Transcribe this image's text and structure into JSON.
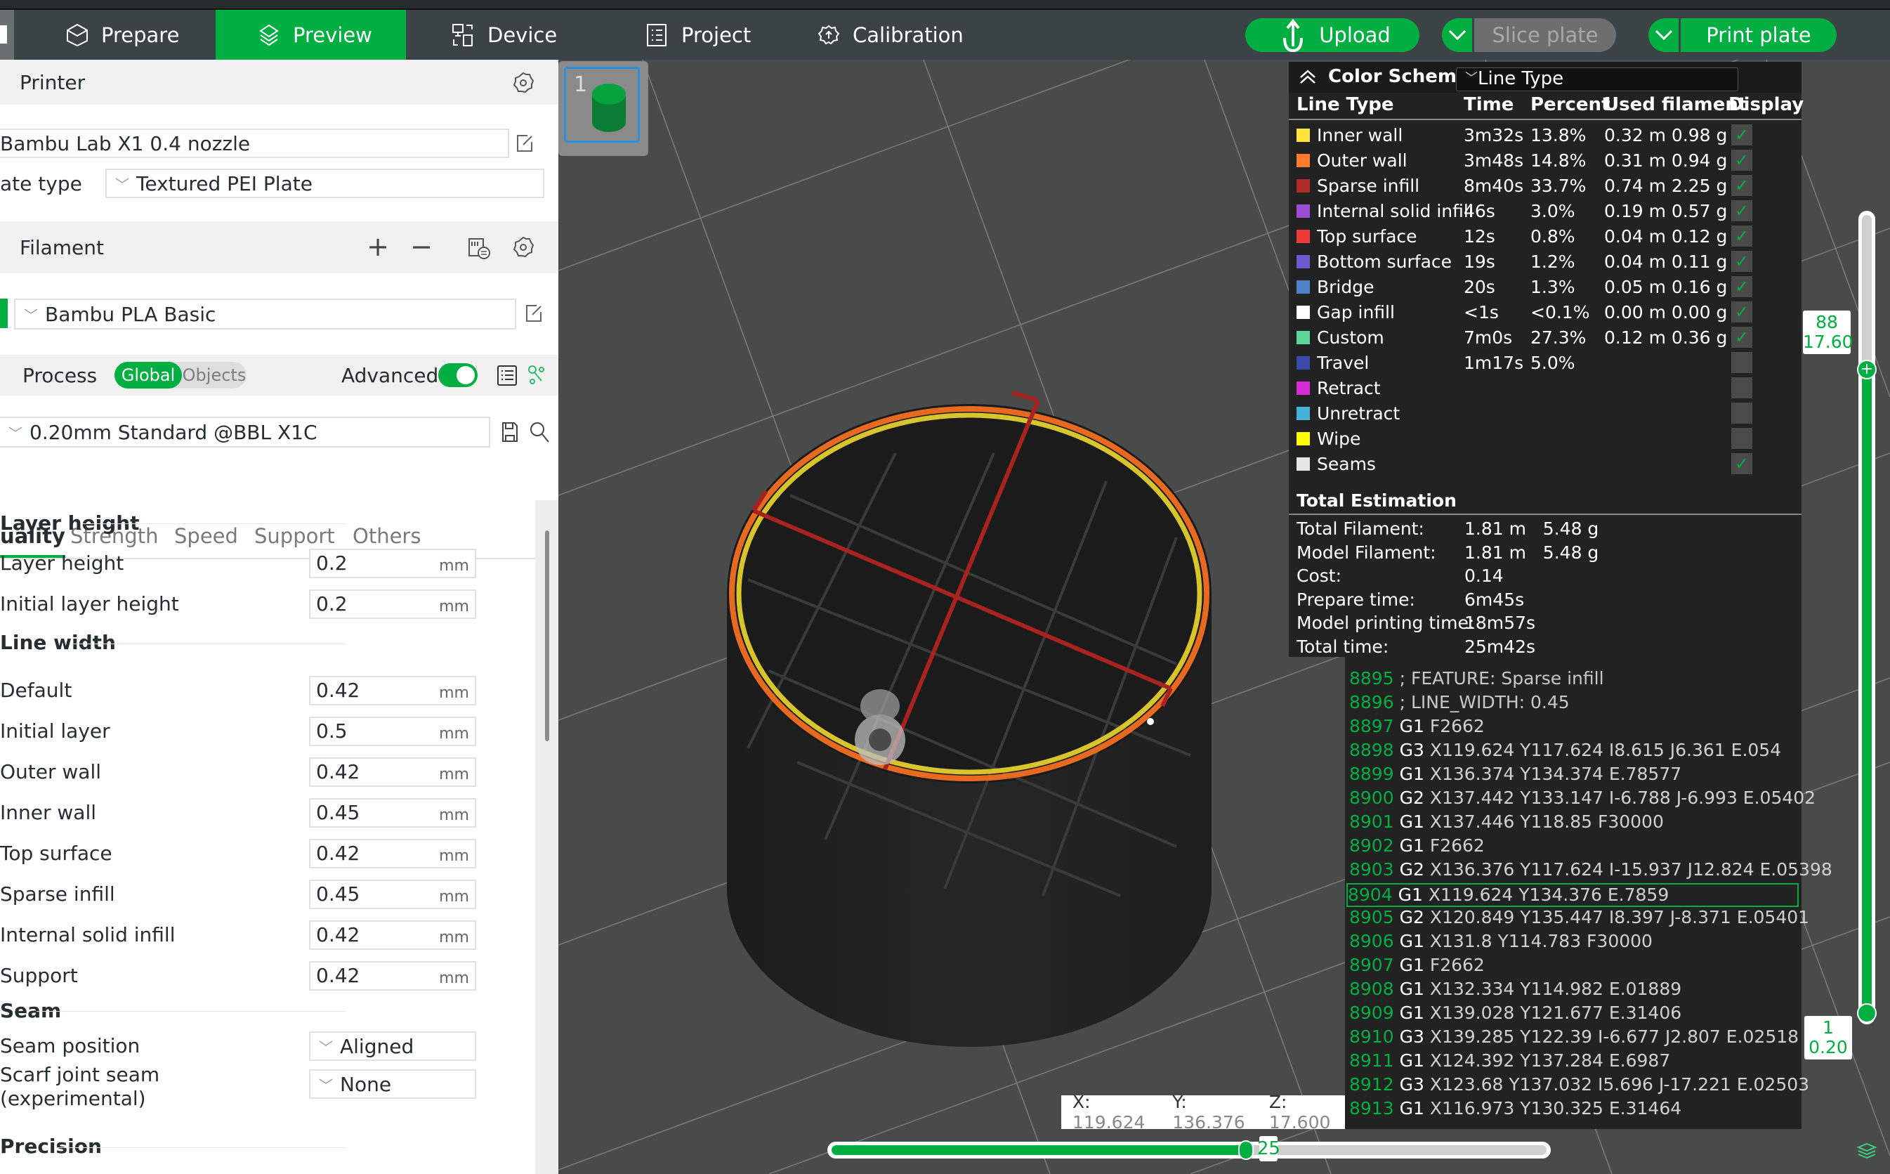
{
  "toolbar": {
    "tabs": [
      {
        "label": "Prepare",
        "icon": "cube-icon",
        "active": false
      },
      {
        "label": "Preview",
        "icon": "layers-icon",
        "active": true
      },
      {
        "label": "Device",
        "icon": "device-icon",
        "active": false
      },
      {
        "label": "Project",
        "icon": "list-icon",
        "active": false
      },
      {
        "label": "Calibration",
        "icon": "calibration-gear-icon",
        "active": false
      }
    ],
    "upload_label": "Upload",
    "slice_label": "Slice plate",
    "print_label": "Print plate",
    "colors": {
      "accent": "#00ae42",
      "toolbar_bg": "#3c4346",
      "disabled": "#6e6e6e"
    }
  },
  "printer": {
    "section_title": "Printer",
    "printer_name": "Bambu Lab X1 0.4 nozzle",
    "plate_type_label": "ate type",
    "plate_type_value": "Textured PEI Plate"
  },
  "filament": {
    "section_title": "Filament",
    "add_icon": "+",
    "remove_icon": "−",
    "items": [
      {
        "name": "Bambu PLA Basic",
        "color": "#00ae42"
      }
    ]
  },
  "process": {
    "section_title": "Process",
    "scope_global": "Global",
    "scope_objects": "Objects",
    "advanced_label": "Advanced",
    "advanced_on": true,
    "preset": "0.20mm Standard @BBL X1C",
    "tabs": [
      "uality",
      "Strength",
      "Speed",
      "Support",
      "Others"
    ],
    "active_tab": 0,
    "groups": {
      "layer_height": {
        "title": "Layer height",
        "rows": [
          {
            "label": "Layer height",
            "value": "0.2",
            "unit": "mm"
          },
          {
            "label": "Initial layer height",
            "value": "0.2",
            "unit": "mm"
          }
        ]
      },
      "line_width": {
        "title": "Line width",
        "rows": [
          {
            "label": "Default",
            "value": "0.42",
            "unit": "mm"
          },
          {
            "label": "Initial layer",
            "value": "0.5",
            "unit": "mm"
          },
          {
            "label": "Outer wall",
            "value": "0.42",
            "unit": "mm"
          },
          {
            "label": "Inner wall",
            "value": "0.45",
            "unit": "mm"
          },
          {
            "label": "Top surface",
            "value": "0.42",
            "unit": "mm"
          },
          {
            "label": "Sparse infill",
            "value": "0.45",
            "unit": "mm"
          },
          {
            "label": "Internal solid infill",
            "value": "0.42",
            "unit": "mm"
          },
          {
            "label": "Support",
            "value": "0.42",
            "unit": "mm"
          }
        ]
      },
      "seam": {
        "title": "Seam",
        "seam_position_label": "Seam position",
        "seam_position_value": "Aligned",
        "scarf_label_1": "Scarf joint seam",
        "scarf_label_2": "(experimental)",
        "scarf_value": "None"
      },
      "precision": {
        "title": "Precision"
      }
    }
  },
  "plate": {
    "number": "1"
  },
  "legend": {
    "color_scheme_label": "Color Scheme",
    "color_scheme_value": "Line Type",
    "columns": [
      "Line Type",
      "Time",
      "Percent",
      "Used filament",
      "Display"
    ],
    "rows": [
      {
        "name": "Inner wall",
        "color": "#ffe53b",
        "time": "3m32s",
        "percent": "13.8%",
        "used": "0.32 m 0.98 g",
        "display": true
      },
      {
        "name": "Outer wall",
        "color": "#ff7b2e",
        "time": "3m48s",
        "percent": "14.8%",
        "used": "0.31 m 0.94 g",
        "display": true
      },
      {
        "name": "Sparse infill",
        "color": "#b02a28",
        "time": "8m40s",
        "percent": "33.7%",
        "used": "0.74 m 2.25 g",
        "display": true
      },
      {
        "name": "Internal solid infill",
        "color": "#9a4fd2",
        "time": "46s",
        "percent": "3.0%",
        "used": "0.19 m 0.57 g",
        "display": true
      },
      {
        "name": "Top surface",
        "color": "#f03a3a",
        "time": "12s",
        "percent": "0.8%",
        "used": "0.04 m 0.12 g",
        "display": true
      },
      {
        "name": "Bottom surface",
        "color": "#6b5ad0",
        "time": "19s",
        "percent": "1.2%",
        "used": "0.04 m 0.11 g",
        "display": true
      },
      {
        "name": "Bridge",
        "color": "#4f82c7",
        "time": "20s",
        "percent": "1.3%",
        "used": "0.05 m 0.16 g",
        "display": true
      },
      {
        "name": "Gap infill",
        "color": "#ffffff",
        "time": "<1s",
        "percent": "<0.1%",
        "used": "0.00 m 0.00 g",
        "display": true
      },
      {
        "name": "Custom",
        "color": "#5fd49a",
        "time": "7m0s",
        "percent": "27.3%",
        "used": "0.12 m 0.36 g",
        "display": true
      },
      {
        "name": "Travel",
        "color": "#3a4aa8",
        "time": "1m17s",
        "percent": "5.0%",
        "used": "",
        "display": false
      },
      {
        "name": "Retract",
        "color": "#d62ad6",
        "time": "",
        "percent": "",
        "used": "",
        "display": false
      },
      {
        "name": "Unretract",
        "color": "#45b0d8",
        "time": "",
        "percent": "",
        "used": "",
        "display": false
      },
      {
        "name": "Wipe",
        "color": "#ffff00",
        "time": "",
        "percent": "",
        "used": "",
        "display": false
      },
      {
        "name": "Seams",
        "color": "#e6e6e6",
        "time": "",
        "percent": "",
        "used": "",
        "display": true
      }
    ],
    "total_title": "Total Estimation",
    "totals": [
      {
        "label": "Total Filament:",
        "value": "1.81 m   5.48 g"
      },
      {
        "label": "Model Filament:",
        "value": "1.81 m   5.48 g"
      },
      {
        "label": "Cost:",
        "value": "0.14"
      },
      {
        "label": "Prepare time:",
        "value": "6m45s"
      },
      {
        "label": "Model printing time:",
        "value": "18m57s"
      },
      {
        "label": "Total time:",
        "value": "25m42s"
      }
    ]
  },
  "gcode": {
    "lines": [
      {
        "n": "8895",
        "cmd": "",
        "args": "; FEATURE: Sparse infill",
        "comment": true
      },
      {
        "n": "8896",
        "cmd": "",
        "args": "; LINE_WIDTH: 0.45",
        "comment": true
      },
      {
        "n": "8897",
        "cmd": "G1",
        "args": "F2662"
      },
      {
        "n": "8898",
        "cmd": "G3",
        "args": "X119.624 Y117.624 I8.615 J6.361 E.054"
      },
      {
        "n": "8899",
        "cmd": "G1",
        "args": "X136.374 Y134.374 E.78577"
      },
      {
        "n": "8900",
        "cmd": "G2",
        "args": "X137.442 Y133.147 I-6.788 J-6.993 E.05402"
      },
      {
        "n": "8901",
        "cmd": "G1",
        "args": "X137.446 Y118.85 F30000"
      },
      {
        "n": "8902",
        "cmd": "G1",
        "args": "F2662"
      },
      {
        "n": "8903",
        "cmd": "G2",
        "args": "X136.376 Y117.624 I-15.937 J12.824 E.05398"
      },
      {
        "n": "8904",
        "cmd": "G1",
        "args": "X119.624 Y134.376 E.7859",
        "highlight": true
      },
      {
        "n": "8905",
        "cmd": "G2",
        "args": "X120.849 Y135.447 I8.397 J-8.371 E.05401"
      },
      {
        "n": "8906",
        "cmd": "G1",
        "args": "X131.8 Y114.783 F30000"
      },
      {
        "n": "8907",
        "cmd": "G1",
        "args": "F2662"
      },
      {
        "n": "8908",
        "cmd": "G1",
        "args": "X132.334 Y114.982 E.01889"
      },
      {
        "n": "8909",
        "cmd": "G1",
        "args": "X139.028 Y121.677 E.31406"
      },
      {
        "n": "8910",
        "cmd": "G3",
        "args": "X139.285 Y122.39 I-6.677 J2.807 E.02518"
      },
      {
        "n": "8911",
        "cmd": "G1",
        "args": "X124.392 Y137.284 E.6987"
      },
      {
        "n": "8912",
        "cmd": "G3",
        "args": "X123.68 Y137.032 I5.696 J-17.221 E.02503"
      },
      {
        "n": "8913",
        "cmd": "G1",
        "args": "X116.973 Y130.325 E.31464"
      }
    ]
  },
  "position_readout": {
    "x_label": "X:",
    "x": "119.624",
    "y_label": "Y:",
    "y": "136.376",
    "z_label": "Z:",
    "z": "17.600"
  },
  "move_slider": {
    "value": "25",
    "fraction": 0.58
  },
  "layer_slider": {
    "top_layer": "88",
    "top_height": "17.60",
    "bottom_layer": "1",
    "bottom_height": "0.20",
    "top_fraction": 0.19
  }
}
